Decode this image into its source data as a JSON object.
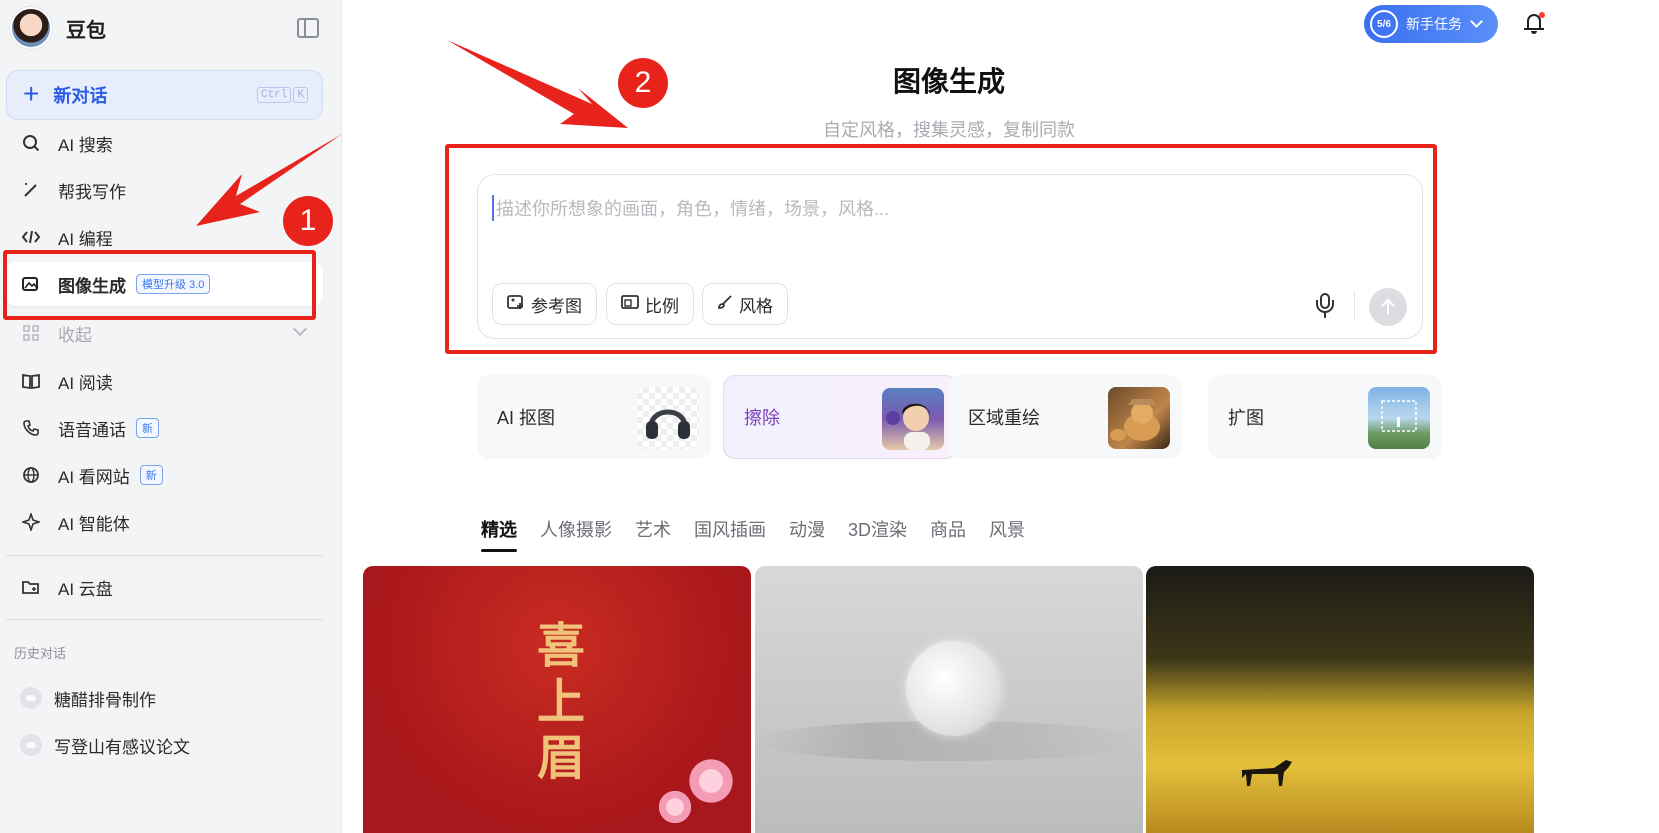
{
  "sidebar": {
    "brand_name": "豆包",
    "new_chat": {
      "label": "新对话",
      "shortcut": [
        "Ctrl",
        "K"
      ]
    },
    "items": [
      {
        "label": "AI 搜索",
        "icon": "search-sparkle-icon"
      },
      {
        "label": "帮我写作",
        "icon": "pen-sparkle-icon"
      },
      {
        "label": "AI 编程",
        "icon": "code-icon"
      },
      {
        "label": "图像生成",
        "icon": "image-sparkle-icon",
        "badge": "模型升级 3.0"
      },
      {
        "label": "收起",
        "icon": "apps-grid-icon"
      },
      {
        "label": "AI 阅读",
        "icon": "book-icon"
      },
      {
        "label": "语音通话",
        "icon": "phone-icon",
        "badge": "新"
      },
      {
        "label": "AI 看网站",
        "icon": "globe-icon",
        "badge": "新"
      },
      {
        "label": "AI 智能体",
        "icon": "sparkle-icon"
      },
      {
        "label": "AI 云盘",
        "icon": "folder-cloud-icon"
      }
    ],
    "history_title": "历史对话",
    "history": [
      {
        "label": "糖醋排骨制作"
      },
      {
        "label": "写登山有感议论文"
      }
    ]
  },
  "header": {
    "task_progress": "5/6",
    "task_label": "新手任务"
  },
  "main": {
    "title": "图像生成",
    "subtitle": "自定风格，搜集灵感，复制同款",
    "composer": {
      "placeholder": "描述你所想象的画面，角色，情绪，场景，风格...",
      "tools": [
        "参考图",
        "比例",
        "风格"
      ]
    },
    "quick_tools": [
      {
        "label": "AI 抠图"
      },
      {
        "label": "擦除"
      },
      {
        "label": "区域重绘"
      },
      {
        "label": "扩图"
      }
    ],
    "tabs": [
      "精选",
      "人像摄影",
      "艺术",
      "国风插画",
      "动漫",
      "3D渲染",
      "商品",
      "风景"
    ],
    "gallery": {
      "item1_text": "喜上眉"
    }
  },
  "annotations": {
    "marker1": "1",
    "marker2": "2",
    "accent_color": "#e8231b"
  },
  "colors": {
    "brand_blue": "#2b5ce6",
    "sidebar_bg": "#f3f4f6"
  }
}
